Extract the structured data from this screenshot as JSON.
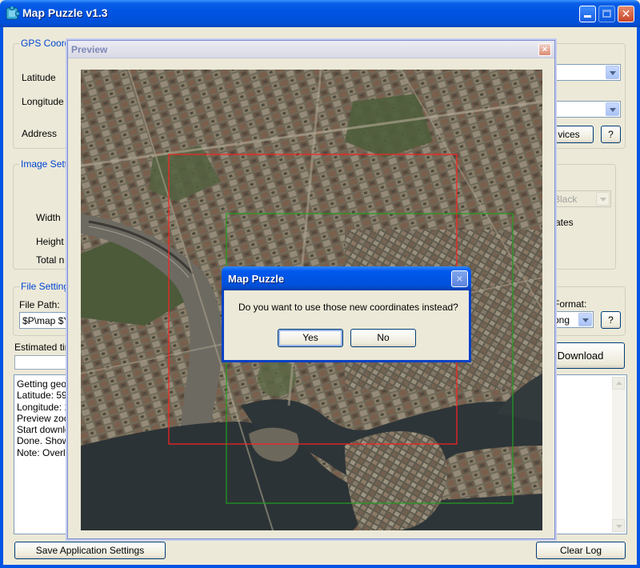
{
  "window": {
    "title": "Map Puzzle v1.3"
  },
  "gps": {
    "group_title": "GPS Coord",
    "latitude_label": "Latitude",
    "longitude_label": "Longitude",
    "address_label": "Address",
    "services_label": "vices",
    "help_label": "?"
  },
  "image_settings": {
    "group_title": "Image Setti",
    "width_label": "Width",
    "height_label": "Height",
    "total_label": "Total n",
    "color_value": "Black",
    "partial_text": "ates"
  },
  "file_settings": {
    "group_title": "File Setting",
    "path_label": "File Path:",
    "path_value": "$P\\map $Y",
    "format_label": "Format:",
    "format_value": "png",
    "help_label": "?"
  },
  "estimated_label": "Estimated tim",
  "download_label": "Download",
  "log": [
    "Getting geo",
    "Latitude: 59",
    "Longitude: 1",
    "Preview zoc",
    "Start downlo",
    "Done. Show",
    "Note: Overla"
  ],
  "save_settings_label": "Save Application Settings",
  "clear_log_label": "Clear Log",
  "preview": {
    "title": "Preview",
    "close_glyph": "×"
  },
  "dialog": {
    "title": "Map Puzzle",
    "message": "Do you want to use those new coordinates instead?",
    "yes_label": "Yes",
    "no_label": "No",
    "close_glyph": "×"
  },
  "colors": {
    "titlebar": "#0054e3",
    "group_title": "#0046d5",
    "red_selection": "#ff2020",
    "green_selection": "#20a020"
  }
}
